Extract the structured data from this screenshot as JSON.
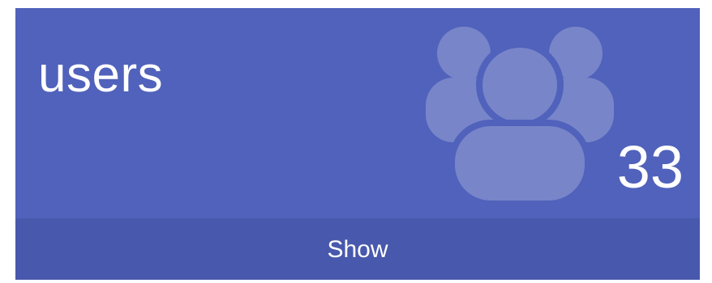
{
  "card": {
    "title": "users",
    "count": "33",
    "icon": "users-group-icon",
    "footer_label": "Show"
  },
  "colors": {
    "card_background": "#5062bb",
    "footer_background": "#4858ac",
    "icon_fill": "#7885c9",
    "text": "#ffffff"
  }
}
